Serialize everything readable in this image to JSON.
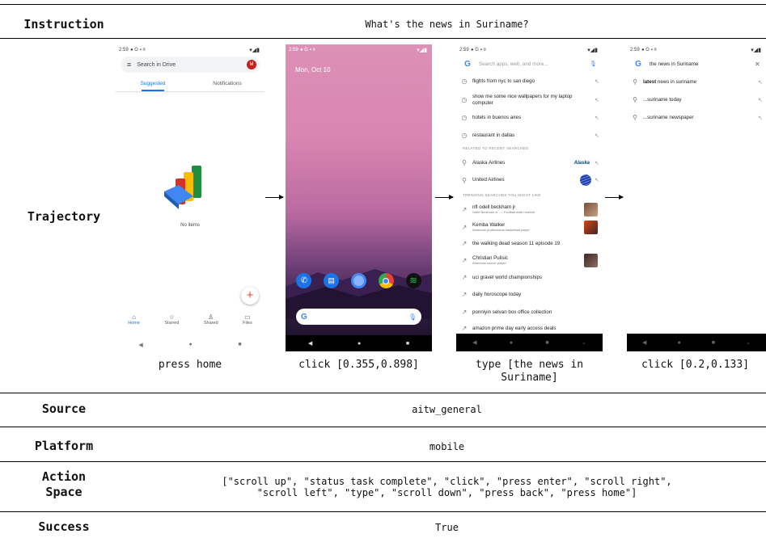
{
  "rows": {
    "instruction_label": "Instruction",
    "instruction_value": "What's the news in Suriname?",
    "trajectory_label": "Trajectory",
    "source_label": "Source",
    "source_value": "aitw_general",
    "platform_label": "Platform",
    "platform_value": "mobile",
    "action_space_label_1": "Action",
    "action_space_label_2": "Space",
    "action_space_line_1": "[\"scroll up\", \"status task complete\", \"click\", \"press enter\", \"scroll right\",",
    "action_space_line_2": "\"scroll left\", \"type\", \"scroll down\", \"press back\", \"press home\"]",
    "success_label": "Success",
    "success_value": "True"
  },
  "captions": {
    "step1": "press home",
    "step2": "click [0.355,0.898]",
    "step3_line1": "type [the news in",
    "step3_line2": "Suriname]",
    "step4": "click [0.2,0.133]"
  },
  "screen1": {
    "time": "2:59",
    "search_placeholder": "Search in Drive",
    "avatar_letter": "M",
    "tab_suggested": "Suggested",
    "tab_notifications": "Notifications",
    "empty_text": "No items",
    "nav_home": "Home",
    "nav_starred": "Starred",
    "nav_shared": "Shared",
    "nav_files": "Files"
  },
  "screen2": {
    "time": "2:59",
    "date": "Mon, Oct 10"
  },
  "screen3": {
    "time": "2:59",
    "placeholder": "Search apps, web, and more...",
    "recent": [
      "flights from nyc to san diego",
      "show me some nice wallpapers for my laptop computer",
      "hotels in buenos aires",
      "restaurant in dallas"
    ],
    "related_header": "RELATED TO RECENT SEARCHES",
    "related": [
      "Alaska Airlines",
      "United Airlines"
    ],
    "alaska_logo": "Alaska",
    "trending_header": "TRENDING SEARCHES YOU MIGHT LIKE",
    "trending": [
      {
        "title": "nfl odell beckham jr",
        "sub": "Odell Beckham Jr. — Football wide receiver"
      },
      {
        "title": "Kemba Walker",
        "sub": "American professional basketball player"
      },
      {
        "title": "the walking dead season 11 episode 19",
        "sub": ""
      },
      {
        "title": "Christian Pulisic",
        "sub": "American soccer player"
      },
      {
        "title": "uci gravel world championships",
        "sub": ""
      },
      {
        "title": "daily horoscope today",
        "sub": ""
      },
      {
        "title": "ponniyin selvan box office collection",
        "sub": ""
      },
      {
        "title": "amazon prime day early access deals",
        "sub": ""
      }
    ]
  },
  "screen4": {
    "time": "2:59",
    "query": "the news in Suriname",
    "suggestions": [
      {
        "bold": "latest",
        "rest": " news in suriname"
      },
      {
        "bold": "",
        "rest": "...suriname today"
      },
      {
        "bold": "",
        "rest": "...suriname newspaper"
      }
    ]
  },
  "colors": {
    "google_blue": "#1a73e8",
    "drive_red": "#d93025",
    "drive_green": "#1e8e3e",
    "drive_yellow": "#fbbc04"
  }
}
